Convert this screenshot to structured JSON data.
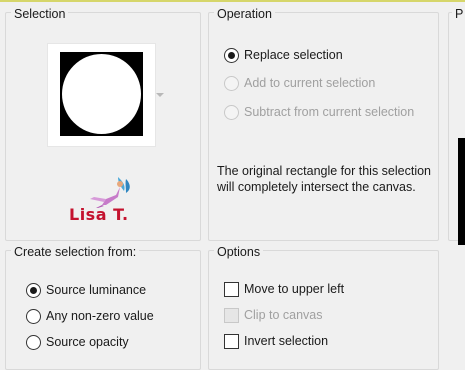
{
  "colors": {
    "background": "#f0f0f0",
    "group_border": "#d9d9d9",
    "logo_red": "#c4122e",
    "disabled_text": "#a0a0a0"
  },
  "selection": {
    "title": "Selection",
    "logo_text": "Lisa T."
  },
  "operation": {
    "title": "Operation",
    "options": [
      {
        "label": "Replace selection",
        "checked": true,
        "enabled": true
      },
      {
        "label": "Add to current selection",
        "checked": false,
        "enabled": false
      },
      {
        "label": "Subtract from current selection",
        "checked": false,
        "enabled": false
      }
    ],
    "note": "The original rectangle for this selection will completely intersect the canvas."
  },
  "create_from": {
    "title": "Create selection from:",
    "options": [
      {
        "label": "Source luminance",
        "checked": true
      },
      {
        "label": "Any non-zero value",
        "checked": false
      },
      {
        "label": "Source opacity",
        "checked": false
      }
    ]
  },
  "options": {
    "title": "Options",
    "items": [
      {
        "label": "Move to upper left",
        "checked": false,
        "enabled": true
      },
      {
        "label": "Clip to canvas",
        "checked": false,
        "enabled": false
      },
      {
        "label": "Invert selection",
        "checked": false,
        "enabled": true
      }
    ]
  },
  "partial_group": {
    "title": "P"
  }
}
